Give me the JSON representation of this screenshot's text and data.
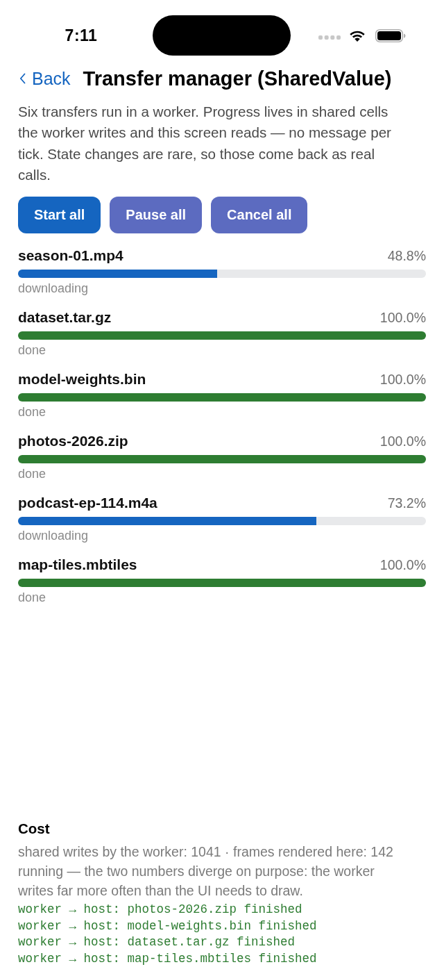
{
  "status_bar": {
    "time": "7:11"
  },
  "nav": {
    "back_label": "Back",
    "title": "Transfer manager (SharedValue)"
  },
  "description": "Six transfers run in a worker. Progress lives in shared cells the worker writes and this screen reads — no message per tick. State changes are rare, so those come back as real calls.",
  "actions": [
    {
      "label": "Start all",
      "kind": "primary"
    },
    {
      "label": "Pause all",
      "kind": "secondary"
    },
    {
      "label": "Cancel all",
      "kind": "secondary"
    }
  ],
  "transfers": [
    {
      "name": "season-01.mp4",
      "percent": "48.8%",
      "status": "downloading",
      "level": 0.488,
      "color": "#1565c0"
    },
    {
      "name": "dataset.tar.gz",
      "percent": "100.0%",
      "status": "done",
      "level": 1,
      "color": "#2e7d32"
    },
    {
      "name": "model-weights.bin",
      "percent": "100.0%",
      "status": "done",
      "level": 1,
      "color": "#2e7d32"
    },
    {
      "name": "photos-2026.zip",
      "percent": "100.0%",
      "status": "done",
      "level": 1,
      "color": "#2e7d32"
    },
    {
      "name": "podcast-ep-114.m4a",
      "percent": "73.2%",
      "status": "downloading",
      "level": 0.732,
      "color": "#1565c0"
    },
    {
      "name": "map-tiles.mbtiles",
      "percent": "100.0%",
      "status": "done",
      "level": 1,
      "color": "#2e7d32"
    }
  ],
  "cost": {
    "title": "Cost",
    "summary": "shared writes by the worker: 1041 · frames rendered here: 142 running — the two numbers diverge on purpose: the worker writes far more often than the UI needs to draw.",
    "log": [
      "worker → host: photos-2026.zip finished",
      "worker → host: model-weights.bin finished",
      "worker → host: dataset.tar.gz finished",
      "worker → host: map-tiles.mbtiles finished"
    ]
  }
}
